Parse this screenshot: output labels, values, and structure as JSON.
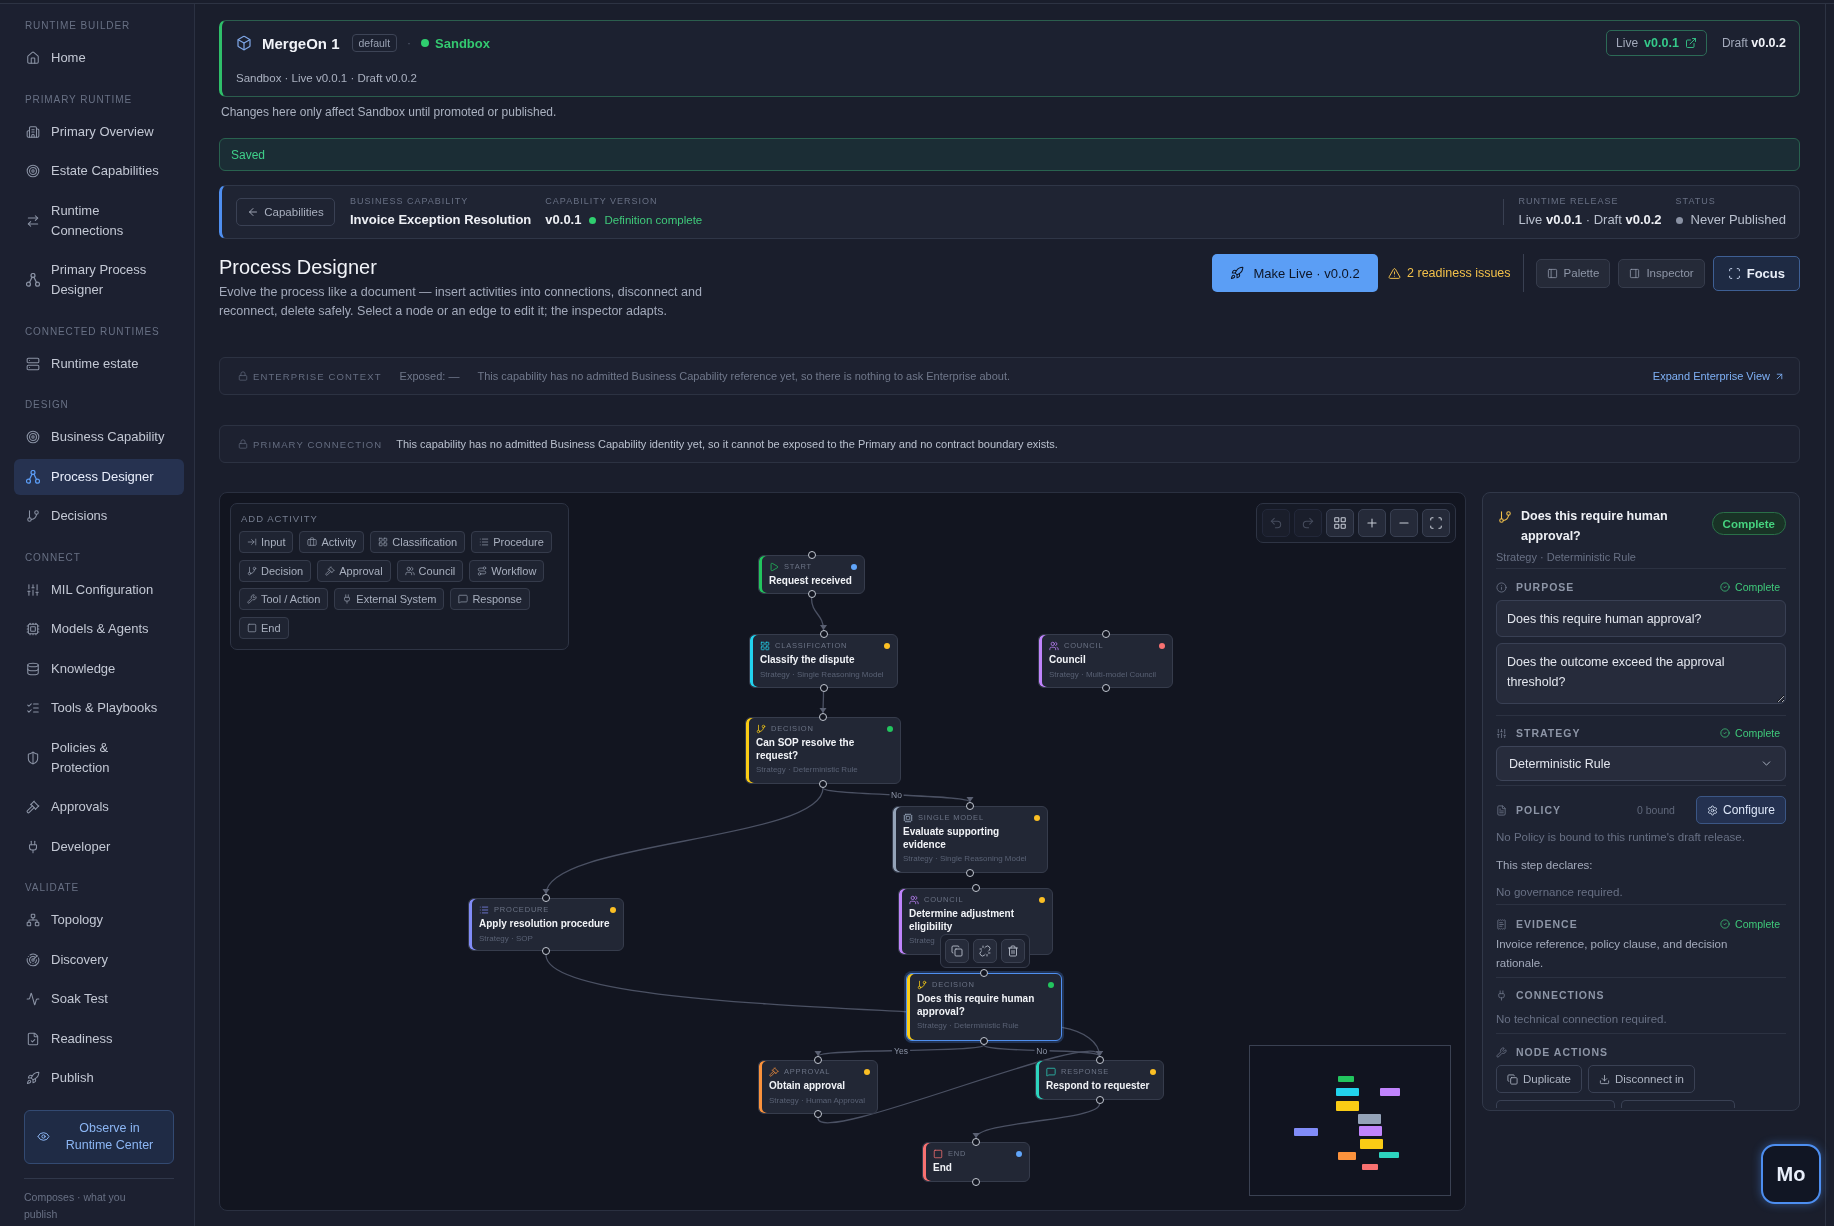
{
  "sidebar": {
    "sections": [
      {
        "label": "RUNTIME BUILDER",
        "items": [
          {
            "label": "Home",
            "selected": false
          }
        ]
      },
      {
        "label": "PRIMARY RUNTIME",
        "items": [
          {
            "label": "Primary Overview",
            "selected": false
          },
          {
            "label": "Estate Capabilities",
            "selected": false
          },
          {
            "label": "Runtime Connections",
            "selected": false
          },
          {
            "label": "Primary Process Designer",
            "selected": false
          }
        ]
      },
      {
        "label": "CONNECTED RUNTIMES",
        "items": [
          {
            "label": "Runtime estate",
            "selected": false
          }
        ]
      },
      {
        "label": "DESIGN",
        "items": [
          {
            "label": "Business Capability",
            "selected": false
          },
          {
            "label": "Process Designer",
            "selected": true
          },
          {
            "label": "Decisions",
            "selected": false
          }
        ]
      },
      {
        "label": "CONNECT",
        "items": [
          {
            "label": "MIL Configuration",
            "selected": false
          },
          {
            "label": "Models & Agents",
            "selected": false
          },
          {
            "label": "Knowledge",
            "selected": false
          },
          {
            "label": "Tools & Playbooks",
            "selected": false
          },
          {
            "label": "Policies & Protection",
            "selected": false
          },
          {
            "label": "Approvals",
            "selected": false
          },
          {
            "label": "Developer",
            "selected": false
          }
        ]
      },
      {
        "label": "VALIDATE",
        "items": [
          {
            "label": "Topology",
            "selected": false
          },
          {
            "label": "Discovery",
            "selected": false
          },
          {
            "label": "Soak Test",
            "selected": false
          },
          {
            "label": "Readiness",
            "selected": false
          },
          {
            "label": "Publish",
            "selected": false
          }
        ]
      }
    ],
    "observe_button": "Observe in Runtime Center",
    "footer": "Composes · what you publish"
  },
  "environment": {
    "name": "MergeOn 1",
    "badge": "default",
    "separator": "·",
    "env_label": "Sandbox",
    "summary": "Sandbox · Live v0.0.1 · Draft v0.0.2",
    "live": {
      "label": "Live",
      "version": "v0.0.1"
    },
    "draft": {
      "label": "Draft",
      "version": "v0.0.2"
    }
  },
  "notice": "Changes here only affect Sandbox until promoted or published.",
  "save_status": "Saved",
  "capability": {
    "back_button": "Capabilities",
    "business": {
      "label": "BUSINESS CAPABILITY",
      "value": "Invoice Exception Resolution"
    },
    "version": {
      "label": "CAPABILITY VERSION",
      "value": "v0.0.1",
      "status": "Definition complete"
    },
    "release": {
      "label": "RUNTIME RELEASE",
      "value": "Live **v0.0.1** · Draft **v0.0.2**"
    },
    "status": {
      "label": "STATUS",
      "value": "Never Published"
    }
  },
  "designer": {
    "title": "Process Designer",
    "description": "Evolve the process like a document — insert activities into connections, disconnect and reconnect, delete safely. Select a node or an edge to edit it; the inspector adapts.",
    "make_live": "Make Live · v0.0.2",
    "readiness": "2 readiness issues",
    "view_buttons": [
      {
        "label": "Palette",
        "active": false
      },
      {
        "label": "Inspector",
        "active": false
      },
      {
        "label": "Focus",
        "active": true
      }
    ]
  },
  "enterprise_context": {
    "label": "ENTERPRISE CONTEXT",
    "exposed": "Exposed: —",
    "message": "This capability has no admitted Business Capability reference yet, so there is nothing to ask Enterprise about.",
    "link": "Expand Enterprise View"
  },
  "primary_connection": {
    "label": "PRIMARY CONNECTION",
    "message": "This capability has no admitted Business Capability identity yet, so it cannot be exposed to the Primary and no contract boundary exists."
  },
  "canvas": {
    "palette": {
      "title": "ADD ACTIVITY",
      "items": [
        {
          "kind": "input",
          "label": "Input"
        },
        {
          "kind": "activity",
          "label": "Activity"
        },
        {
          "kind": "classification",
          "label": "Classification"
        },
        {
          "kind": "procedure",
          "label": "Procedure"
        },
        {
          "kind": "decision",
          "label": "Decision"
        },
        {
          "kind": "approval",
          "label": "Approval"
        },
        {
          "kind": "council",
          "label": "Council"
        },
        {
          "kind": "workflow",
          "label": "Workflow"
        },
        {
          "kind": "tool",
          "label": "Tool / Action"
        },
        {
          "kind": "external",
          "label": "External System"
        },
        {
          "kind": "response",
          "label": "Response"
        },
        {
          "kind": "end",
          "label": "End"
        }
      ]
    },
    "tools": [
      {
        "disabled": true
      },
      {
        "disabled": true
      },
      {
        "disabled": false
      },
      {
        "disabled": false
      },
      {
        "disabled": false
      },
      {
        "disabled": false
      }
    ],
    "nodes": [
      {
        "kind": "start",
        "type_label": "START",
        "title": "Request received",
        "color": "#60a5fa",
        "selected": false
      },
      {
        "kind": "classification",
        "type_label": "CLASSIFICATION",
        "title": "Classify the dispute",
        "strategy": "Strategy · Single Reasoning Model",
        "color": "#fbbf24",
        "selected": false
      },
      {
        "kind": "council",
        "type_label": "COUNCIL",
        "title": "Council",
        "strategy": "Strategy · Multi-model Council",
        "color": "#f87171",
        "selected": false
      },
      {
        "kind": "decision",
        "type_label": "DECISION",
        "title": "Can SOP resolve the request?",
        "strategy": "Strategy · Deterministic Rule",
        "color": "#22c55e",
        "selected": false
      },
      {
        "kind": "single_model",
        "type_label": "SINGLE MODEL",
        "title": "Evaluate supporting evidence",
        "strategy": "Strategy · Single Reasoning Model",
        "color": "#fbbf24",
        "selected": false
      },
      {
        "kind": "procedure",
        "type_label": "PROCEDURE",
        "title": "Apply resolution procedure",
        "strategy": "Strategy · SOP",
        "color": "#fbbf24",
        "selected": false
      },
      {
        "kind": "council",
        "type_label": "COUNCIL",
        "title": "Determine adjustment eligibility",
        "strategy": "Strateg",
        "color": "#fbbf24",
        "selected": false
      },
      {
        "kind": "decision",
        "type_label": "DECISION",
        "title": "Does this require human approval?",
        "strategy": "Strategy · Deterministic Rule",
        "color": "#22c55e",
        "selected": true
      },
      {
        "kind": "approval",
        "type_label": "APPROVAL",
        "title": "Obtain approval",
        "strategy": "Strategy · Human Approval",
        "color": "#fbbf24",
        "selected": false
      },
      {
        "kind": "response",
        "type_label": "RESPONSE",
        "title": "Respond to requester",
        "color": "#fbbf24",
        "selected": false
      },
      {
        "kind": "end",
        "type_label": "END",
        "title": "End",
        "color": "#60a5fa",
        "selected": false
      }
    ],
    "edge_labels": [
      "No",
      "Yes",
      "No"
    ]
  },
  "inspector": {
    "title": "Does this require human approval?",
    "badge": "Complete",
    "subtitle": "Strategy · Deterministic Rule",
    "sections": [
      {
        "kind": "purpose",
        "label": "PURPOSE",
        "status": "Complete",
        "name_value": "Does this require human approval?",
        "question_value": "Does the outcome exceed the approval threshold?"
      },
      {
        "kind": "strategy",
        "label": "STRATEGY",
        "status": "Complete",
        "value": "Deterministic Rule"
      },
      {
        "kind": "policy",
        "label": "POLICY",
        "count": "0 bound",
        "button": "Configure",
        "message": "No Policy is bound to this runtime's draft release.",
        "declares_label": "This step declares:",
        "declares_value": "No governance required."
      },
      {
        "kind": "evidence",
        "label": "EVIDENCE",
        "status": "Complete",
        "text": "Invoice reference, policy clause, and decision rationale."
      },
      {
        "kind": "connections",
        "label": "CONNECTIONS",
        "text": "No technical connection required."
      },
      {
        "kind": "actions",
        "label": "NODE ACTIONS",
        "buttons": [
          {
            "kind": "full",
            "label": "Duplicate"
          },
          {
            "kind": "full",
            "label": "Disconnect in"
          },
          {
            "kind": "cut"
          },
          {
            "kind": "cut"
          }
        ]
      }
    ]
  },
  "assistant_button": "Mo"
}
